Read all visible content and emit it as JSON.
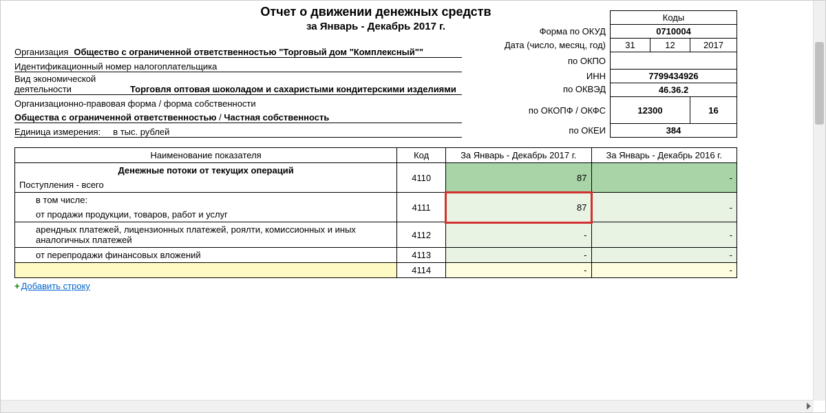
{
  "title": "Отчет о движении денежных средств",
  "subtitle": "за Январь - Декабрь 2017 г.",
  "codes": {
    "header": "Коды",
    "okud_label": "Форма по ОКУД",
    "okud": "0710004",
    "date_label": "Дата (число, месяц, год)",
    "date_d": "31",
    "date_m": "12",
    "date_y": "2017",
    "okpo_label": "по ОКПО",
    "okpo": "",
    "inn_label": "ИНН",
    "inn": "7799434926",
    "okved_label": "по ОКВЭД",
    "okved": "46.36.2",
    "okopf_label": "по ОКОПФ / ОКФС",
    "okopf": "12300",
    "okfs": "16",
    "okei_label": "по ОКЕИ",
    "okei": "384"
  },
  "info": {
    "org_label": "Организация",
    "org_value": "Общество с ограниченной ответственностью \"Торговый дом \"Комплексный\"\"",
    "inn_label": "Идентификационный номер налогоплательщика",
    "activity_label": "Вид экономической деятельности",
    "activity_value": "Торговля оптовая шоколадом и сахаристыми кондитерскими изделиями",
    "opf_label": "Организационно-правовая форма / форма собственности",
    "opf_value1": "Общества с ограниченной ответственностью",
    "opf_sep": " / ",
    "opf_value2": "Частная собственность",
    "unit_label": "Единица измерения:",
    "unit_value": "в тыс. рублей"
  },
  "table": {
    "h_name": "Наименование показателя",
    "h_code": "Код",
    "h_p1": "За Январь - Декабрь 2017 г.",
    "h_p2": "За Январь - Декабрь 2016 г.",
    "section1": "Денежные потоки от текущих операций",
    "rows": [
      {
        "name": "Поступления - всего",
        "code": "4110",
        "p1": "87",
        "p2": "-",
        "bg1": "bg-green1",
        "bg2": "bg-green1"
      },
      {
        "name": "в том числе:",
        "code": "",
        "p1": "",
        "p2": "",
        "indent": "indent1",
        "bg1": "",
        "bg2": "bg-green2",
        "red1": true
      },
      {
        "name": "от продажи продукции, товаров, работ и услуг",
        "code": "4111",
        "p1": "87",
        "p2": "-",
        "indent": "indent1",
        "bg1": "bg-green2",
        "bg2": "bg-green2",
        "red1": true
      },
      {
        "name": "арендных платежей, лицензионных платежей, роялти, комиссионных и иных аналогичных платежей",
        "code": "4112",
        "p1": "-",
        "p2": "-",
        "indent": "indent1",
        "bg1": "bg-green2",
        "bg2": "bg-green2"
      },
      {
        "name": "от перепродажи финансовых вложений",
        "code": "4113",
        "p1": "-",
        "p2": "-",
        "indent": "indent1",
        "bg1": "bg-green2",
        "bg2": "bg-green2"
      },
      {
        "name": "",
        "code": "4114",
        "p1": "-",
        "p2": "-",
        "indent": "indent1",
        "bg1": "bg-yellow2",
        "bg2": "bg-yellow2",
        "namebg": "bg-yellow"
      }
    ]
  },
  "add_row": "Добавить строку"
}
